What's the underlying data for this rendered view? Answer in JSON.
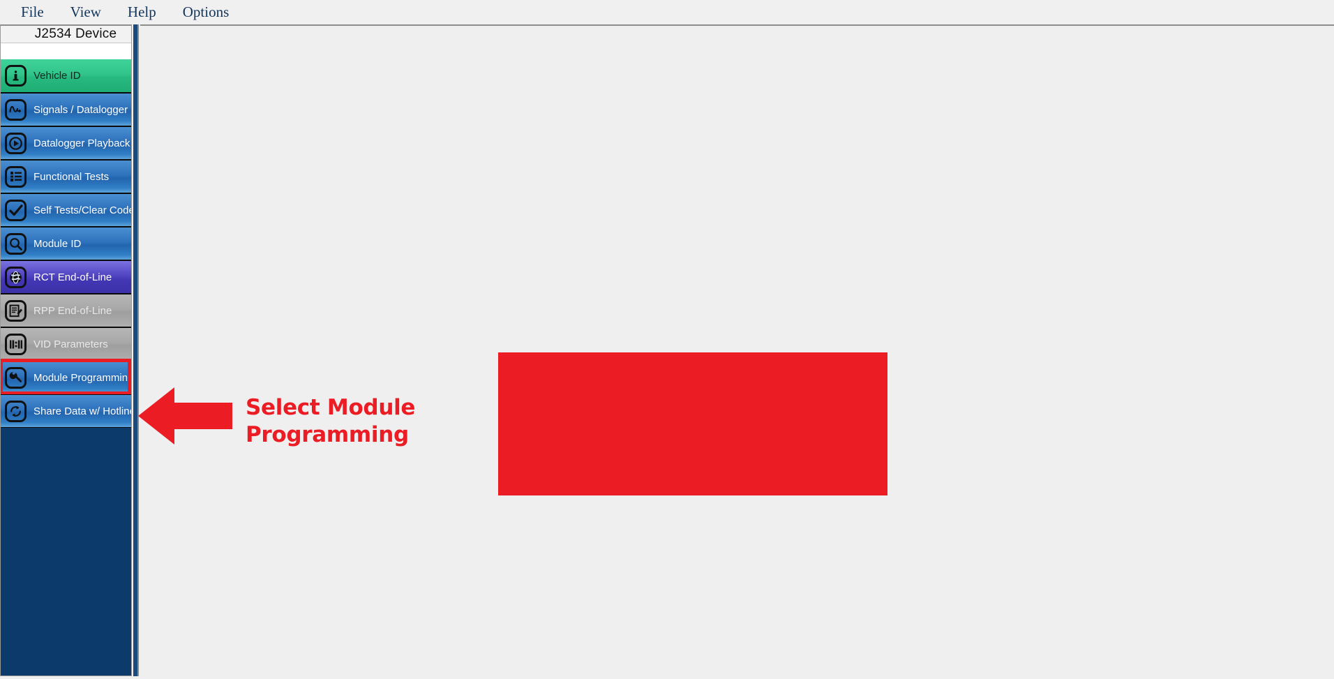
{
  "menubar": {
    "items": [
      {
        "label": "File",
        "name": "menu-file"
      },
      {
        "label": "View",
        "name": "menu-view"
      },
      {
        "label": "Help",
        "name": "menu-help"
      },
      {
        "label": "Options",
        "name": "menu-options"
      }
    ]
  },
  "sidebar": {
    "header_title": "J2534 Device",
    "items": [
      {
        "label": "Vehicle ID",
        "icon": "info-icon",
        "theme": "green",
        "state": "active"
      },
      {
        "label": "Signals / Datalogger",
        "icon": "waveform-icon",
        "theme": "blue",
        "state": "enabled"
      },
      {
        "label": "Datalogger Playback",
        "icon": "play-icon",
        "theme": "blue",
        "state": "enabled"
      },
      {
        "label": "Functional Tests",
        "icon": "list-icon",
        "theme": "blue",
        "state": "enabled"
      },
      {
        "label": "Self Tests/Clear Codes",
        "icon": "checkmark-icon",
        "theme": "blue",
        "state": "enabled"
      },
      {
        "label": "Module ID",
        "icon": "magnifier-icon",
        "theme": "blue",
        "state": "enabled"
      },
      {
        "label": "RCT End-of-Line",
        "icon": "globe-icon",
        "theme": "purple",
        "state": "enabled"
      },
      {
        "label": "RPP End-of-Line",
        "icon": "document-edit-icon",
        "theme": "gray",
        "state": "disabled"
      },
      {
        "label": "VID Parameters",
        "icon": "one-to-one-icon",
        "theme": "gray",
        "state": "disabled"
      },
      {
        "label": "Module Programming",
        "icon": "wrench-icon",
        "theme": "blue",
        "state": "highlighted"
      },
      {
        "label": "Share Data w/ Hotline",
        "icon": "sync-arrows-icon",
        "theme": "blue",
        "state": "enabled"
      }
    ]
  },
  "annotation": {
    "text_line1": "Select Module",
    "text_line2": "Programming",
    "arrow_direction": "left",
    "color": "#EC1C24"
  },
  "redaction": {
    "color": "#EC1C24"
  },
  "colors": {
    "accent_red": "#EC1C24",
    "sidebar_navy": "#0B3A6B",
    "menu_text": "#12355B",
    "content_bg": "#EFEFEF"
  }
}
